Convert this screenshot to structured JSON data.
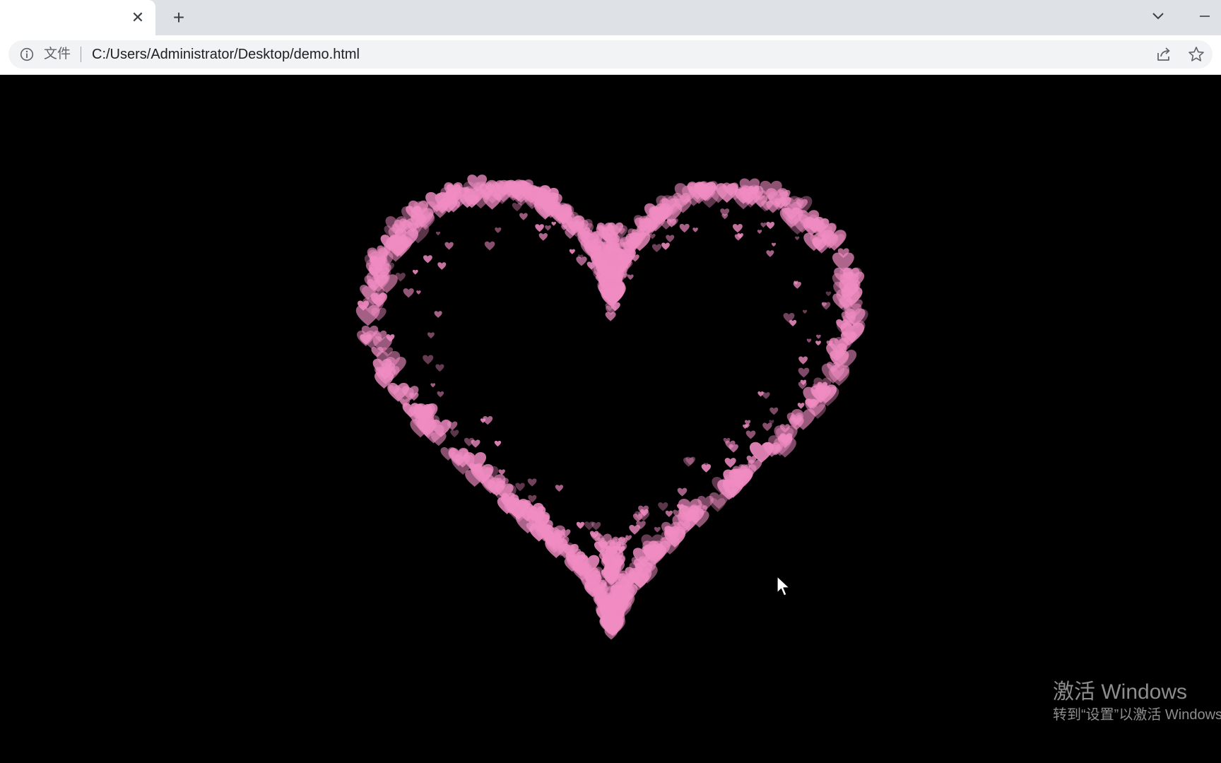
{
  "browser": {
    "tab": {
      "title": "",
      "close_glyph": "✕"
    },
    "new_tab_glyph": "+",
    "icons": {
      "tab_search": "chevron-down-icon",
      "minimize": "minimize-icon",
      "site_info": "info-icon",
      "share": "share-icon",
      "bookmark": "star-icon"
    },
    "address_bar": {
      "chip_label": "文件",
      "url": "C:/Users/Administrator/Desktop/demo.html"
    }
  },
  "page": {
    "background_color": "#000000",
    "heart_color": "#f08cc2",
    "animation": "heart-particles"
  },
  "watermark": {
    "title": "激活 Windows",
    "subtitle": "转到“设置”以激活 Windows"
  },
  "colors": {
    "tabstrip_bg": "#dee1e6",
    "toolbar_bg": "#ffffff",
    "omnibox_bg": "#f1f3f4"
  }
}
